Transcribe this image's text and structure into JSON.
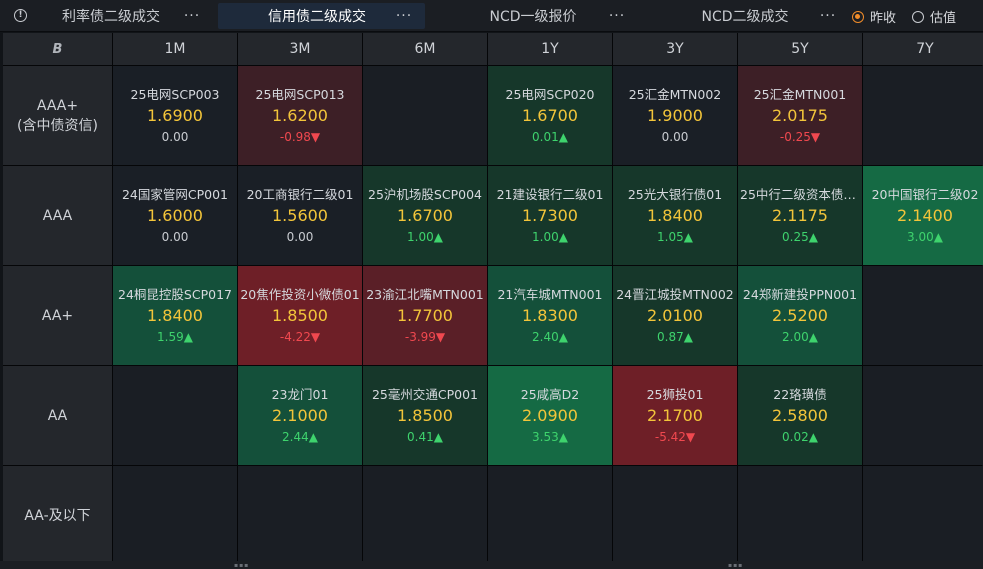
{
  "tabs": [
    {
      "label": "利率债二级成交"
    },
    {
      "label": "信用债二级成交"
    },
    {
      "label": "NCD一级报价"
    },
    {
      "label": "NCD二级成交"
    }
  ],
  "more_label": "···",
  "radios": [
    {
      "label": "昨收",
      "checked": true
    },
    {
      "label": "估值",
      "checked": false
    }
  ],
  "corner_logo": "B",
  "columns": [
    "1M",
    "3M",
    "6M",
    "1Y",
    "3Y",
    "5Y",
    "7Y"
  ],
  "rows": [
    {
      "label": "AAA+",
      "sublabel": "(含中债资信)",
      "cells": [
        {
          "name": "25电网SCP003",
          "price": "1.6900",
          "change": "0.00",
          "dir": "zero",
          "tone": "flat"
        },
        {
          "name": "25电网SCP013",
          "price": "1.6200",
          "change": "-0.98▼",
          "dir": "down",
          "tone": "down1"
        },
        null,
        {
          "name": "25电网SCP020",
          "price": "1.6700",
          "change": "0.01▲",
          "dir": "up",
          "tone": "up1"
        },
        {
          "name": "25汇金MTN002",
          "price": "1.9000",
          "change": "0.00",
          "dir": "zero",
          "tone": "flat"
        },
        {
          "name": "25汇金MTN001",
          "price": "2.0175",
          "change": "-0.25▼",
          "dir": "down",
          "tone": "down1"
        },
        null
      ]
    },
    {
      "label": "AAA",
      "sublabel": "",
      "cells": [
        {
          "name": "24国家管网CP001",
          "price": "1.6000",
          "change": "0.00",
          "dir": "zero",
          "tone": "flat"
        },
        {
          "name": "20工商银行二级01",
          "price": "1.5600",
          "change": "0.00",
          "dir": "zero",
          "tone": "flat"
        },
        {
          "name": "25沪机场股SCP004",
          "price": "1.6700",
          "change": "1.00▲",
          "dir": "up",
          "tone": "up1"
        },
        {
          "name": "21建设银行二级01",
          "price": "1.7300",
          "change": "1.00▲",
          "dir": "up",
          "tone": "up1"
        },
        {
          "name": "25光大银行债01",
          "price": "1.8400",
          "change": "1.05▲",
          "dir": "up",
          "tone": "up1"
        },
        {
          "name": "25中行二级资本债0...",
          "price": "2.1175",
          "change": "0.25▲",
          "dir": "up",
          "tone": "up1"
        },
        {
          "name": "20中国银行二级02",
          "price": "2.1400",
          "change": "3.00▲",
          "dir": "up",
          "tone": "up3"
        }
      ]
    },
    {
      "label": "AA+",
      "sublabel": "",
      "cells": [
        {
          "name": "24桐昆控股SCP017",
          "price": "1.8400",
          "change": "1.59▲",
          "dir": "up",
          "tone": "up2"
        },
        {
          "name": "20焦作投资小微债01",
          "price": "1.8500",
          "change": "-4.22▼",
          "dir": "down",
          "tone": "down3"
        },
        {
          "name": "23渝江北嘴MTN001",
          "price": "1.7700",
          "change": "-3.99▼",
          "dir": "down",
          "tone": "down2"
        },
        {
          "name": "21汽车城MTN001",
          "price": "1.8300",
          "change": "2.40▲",
          "dir": "up",
          "tone": "up2"
        },
        {
          "name": "24晋江城投MTN002",
          "price": "2.0100",
          "change": "0.87▲",
          "dir": "up",
          "tone": "up1"
        },
        {
          "name": "24郑新建投PPN001",
          "price": "2.5200",
          "change": "2.00▲",
          "dir": "up",
          "tone": "up2"
        },
        null
      ]
    },
    {
      "label": "AA",
      "sublabel": "",
      "cells": [
        null,
        {
          "name": "23龙门01",
          "price": "2.1000",
          "change": "2.44▲",
          "dir": "up",
          "tone": "up2"
        },
        {
          "name": "25毫州交通CP001",
          "price": "1.8500",
          "change": "0.41▲",
          "dir": "up",
          "tone": "up1"
        },
        {
          "name": "25咸高D2",
          "price": "2.0900",
          "change": "3.53▲",
          "dir": "up",
          "tone": "up3"
        },
        {
          "name": "25狮投01",
          "price": "2.1700",
          "change": "-5.42▼",
          "dir": "down",
          "tone": "down3"
        },
        {
          "name": "22珞璜债",
          "price": "2.5800",
          "change": "0.02▲",
          "dir": "up",
          "tone": "up1"
        },
        null
      ]
    },
    {
      "label": "AA-及以下",
      "sublabel": "",
      "cells": [
        null,
        null,
        null,
        null,
        null,
        null,
        null
      ]
    }
  ],
  "colors": {
    "price": "#f3c53a",
    "up": "#3ed36d",
    "down": "#f0484f",
    "accent": "#f08c2a",
    "active_tab": "#1e2a3b"
  }
}
